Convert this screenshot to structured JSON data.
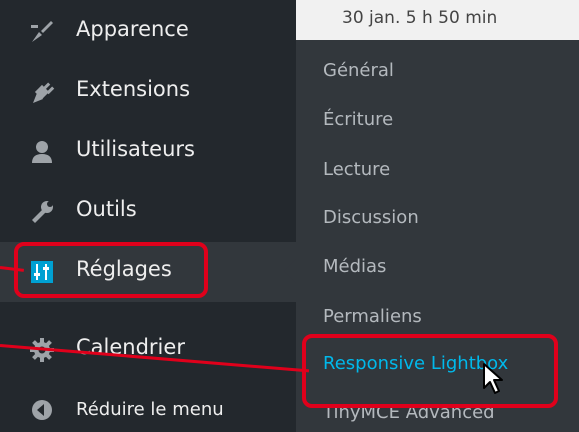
{
  "header": {
    "date_text": "30 jan. 5 h 50 min"
  },
  "sidebar": {
    "items": [
      {
        "label": "Apparence",
        "icon": "brush-icon"
      },
      {
        "label": "Extensions",
        "icon": "plug-icon"
      },
      {
        "label": "Utilisateurs",
        "icon": "user-icon"
      },
      {
        "label": "Outils",
        "icon": "wrench-icon"
      },
      {
        "label": "Réglages",
        "icon": "settings-sliders-icon"
      },
      {
        "label": "Calendrier",
        "icon": "gear-icon"
      }
    ],
    "collapse_label": "Réduire le menu"
  },
  "submenu": {
    "items": [
      "Général",
      "Écriture",
      "Lecture",
      "Discussion",
      "Médias",
      "Permaliens",
      "Responsive Lightbox",
      "TinyMCE Advanced"
    ]
  },
  "colors": {
    "sidebar_bg": "#23282d",
    "submenu_bg": "#32373c",
    "active": "#0073aa",
    "highlight_text": "#00b9eb",
    "annotation": "#e0001b"
  }
}
